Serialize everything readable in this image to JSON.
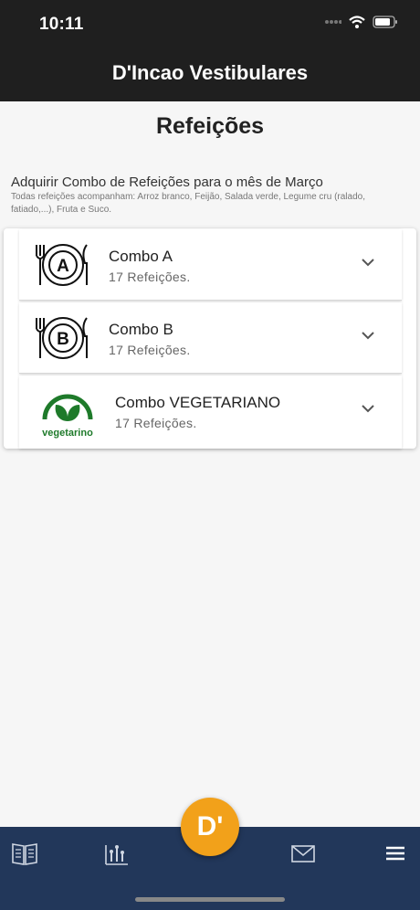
{
  "status_bar": {
    "time": "10:11"
  },
  "header": {
    "title": "D'Incao Vestibulares"
  },
  "page": {
    "title": "Refeições",
    "subtitle": "Adquirir Combo de Refeições para o mês de Março",
    "note": "Todas refeições acompanham: Arroz branco, Feijão, Salada verde, Legume cru (ralado, fatiado,...), Fruta e Suco."
  },
  "combos": [
    {
      "name": "Combo A",
      "meals": "17 Refeições.",
      "icon": "plate-a-icon",
      "letter": "A"
    },
    {
      "name": "Combo B",
      "meals": "17 Refeições.",
      "icon": "plate-b-icon",
      "letter": "B"
    },
    {
      "name": "Combo VEGETARIANO",
      "meals": "17 Refeições.",
      "icon": "vegetarian-icon",
      "logo_text": "vegetarino"
    }
  ],
  "fab": {
    "label": "D'"
  },
  "nav": {
    "items": [
      "book-icon",
      "chart-icon",
      "mail-icon",
      "menu-icon"
    ]
  },
  "colors": {
    "header_bg": "#1f1f1f",
    "nav_bg": "#22375a",
    "fab_bg": "#f2a11a",
    "vegetarian_green": "#1e7a2a"
  }
}
